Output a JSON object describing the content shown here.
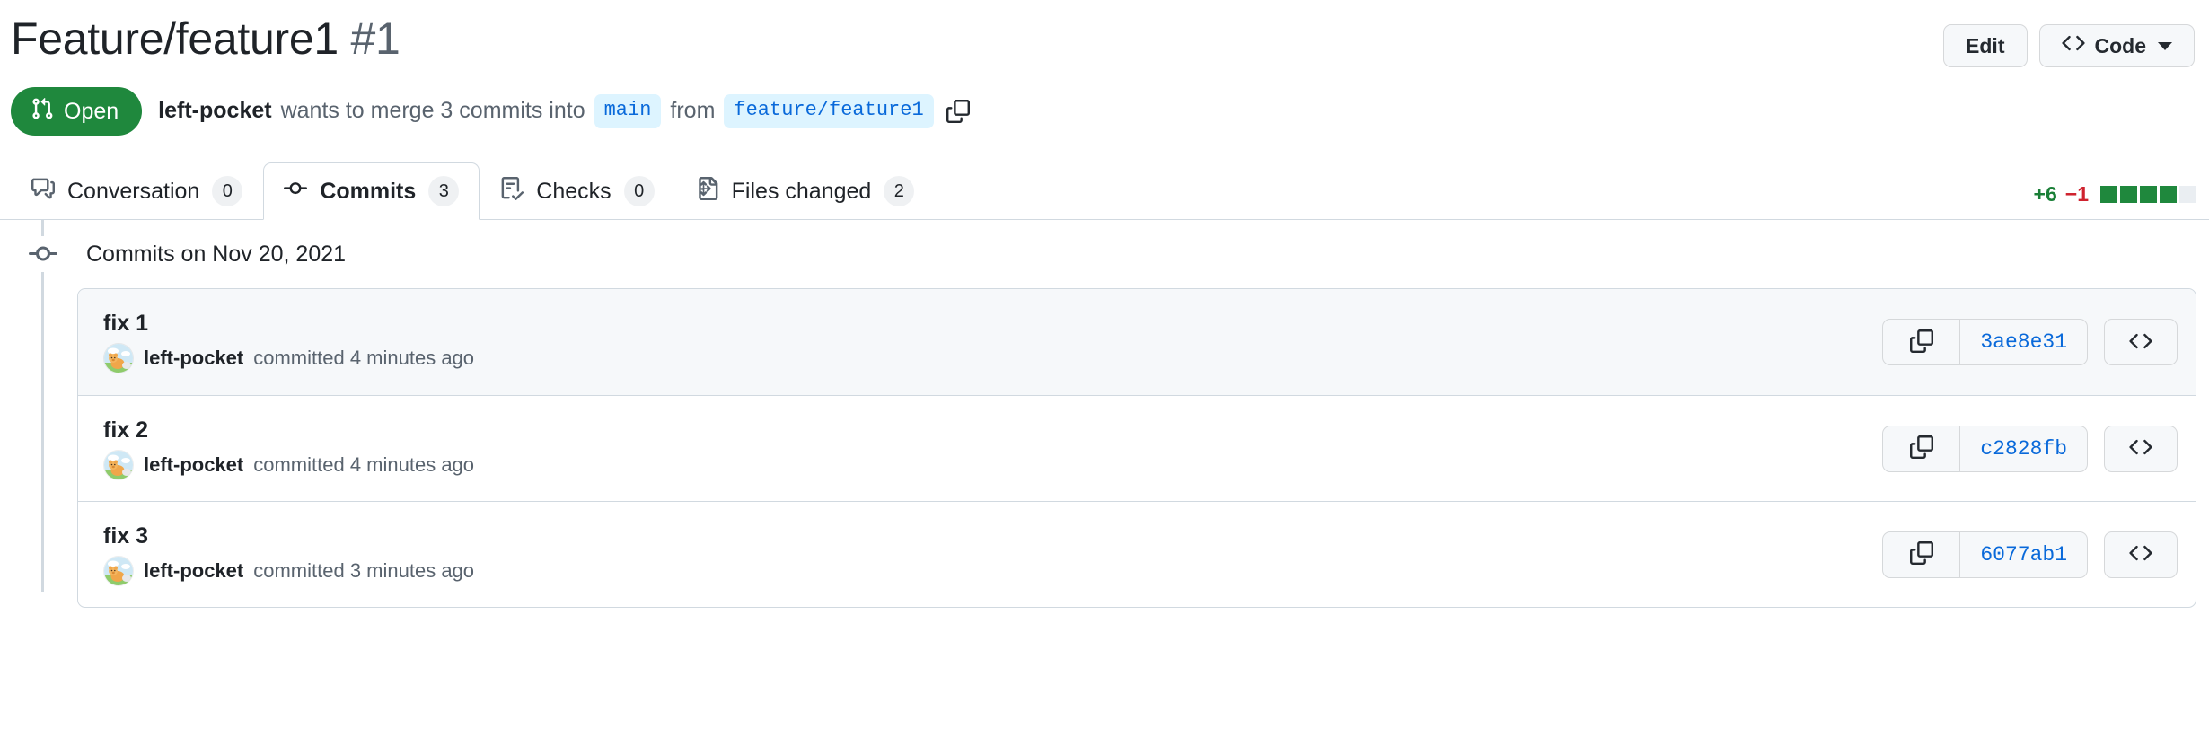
{
  "header": {
    "title": "Feature/feature1",
    "number": "#1",
    "edit_label": "Edit",
    "code_label": "Code"
  },
  "status": {
    "state_label": "Open",
    "author": "left-pocket",
    "text_before": "wants to merge 3 commits into",
    "base_branch": "main",
    "text_middle": "from",
    "head_branch": "feature/feature1"
  },
  "tabs": [
    {
      "label": "Conversation",
      "count": "0",
      "icon": "comment-discussion-icon",
      "selected": false
    },
    {
      "label": "Commits",
      "count": "3",
      "icon": "git-commit-icon",
      "selected": true
    },
    {
      "label": "Checks",
      "count": "0",
      "icon": "checklist-icon",
      "selected": false
    },
    {
      "label": "Files changed",
      "count": "2",
      "icon": "file-diff-icon",
      "selected": false
    }
  ],
  "diffstat": {
    "additions": "+6",
    "deletions": "−1",
    "blocks": [
      "on",
      "on",
      "on",
      "on",
      "off"
    ]
  },
  "commits_group": {
    "header": "Commits on Nov 20, 2021"
  },
  "commits": [
    {
      "title": "fix 1",
      "author": "left-pocket",
      "meta": "committed 4 minutes ago",
      "sha": "3ae8e31",
      "shaded": true
    },
    {
      "title": "fix 2",
      "author": "left-pocket",
      "meta": "committed 4 minutes ago",
      "sha": "c2828fb",
      "shaded": false
    },
    {
      "title": "fix 3",
      "author": "left-pocket",
      "meta": "committed 3 minutes ago",
      "sha": "6077ab1",
      "shaded": false
    }
  ],
  "colors": {
    "open_green": "#1f883d",
    "link_blue": "#0969da",
    "branch_chip_bg": "#ddf4ff",
    "addition_green": "#1a7f37",
    "deletion_red": "#cf222e",
    "border": "#d1d9e0",
    "shaded_row": "#f6f8fa"
  }
}
